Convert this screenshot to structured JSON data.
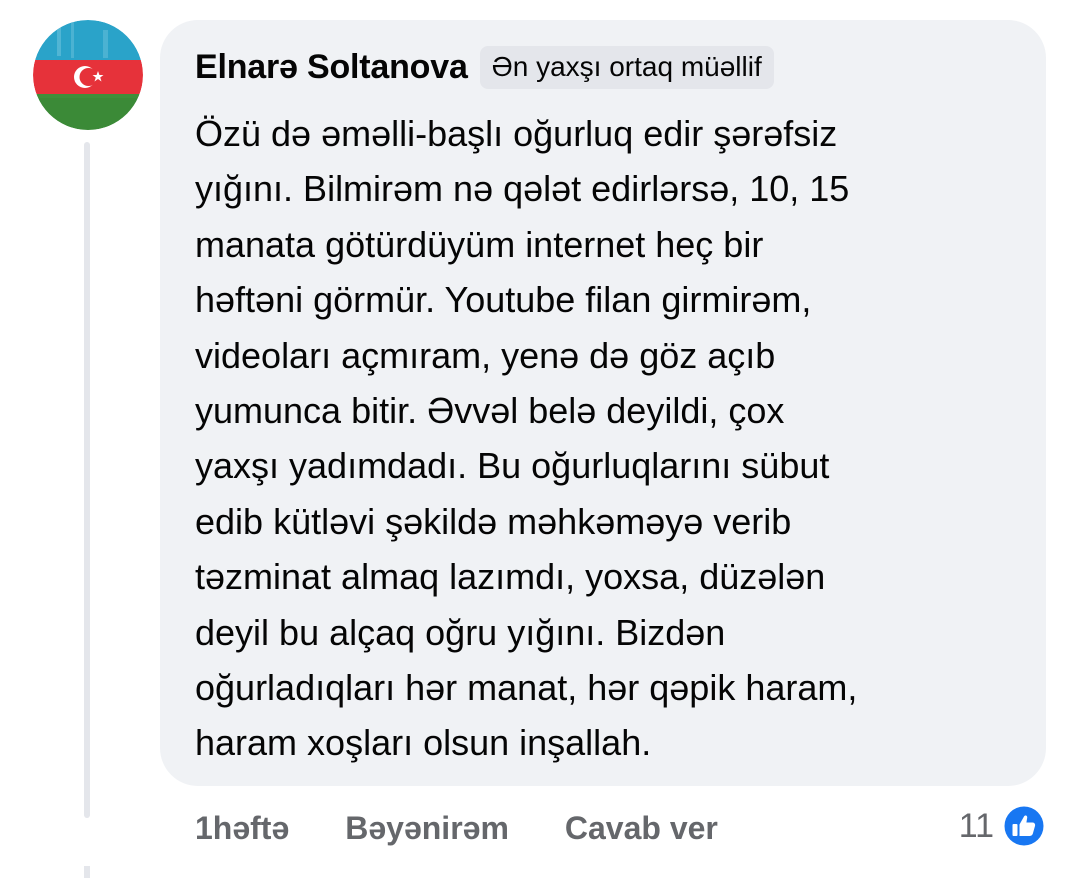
{
  "comment": {
    "author": "Elnarə Soltanova",
    "badge": "Ən yaxşı ortaq müəllif",
    "text": "Özü də əməlli-başlı oğurluq edir şərəfsiz\nyığını. Bilmirəm nə qələt edirlərsə, 10, 15\nmanata götürdüyüm internet heç bir\nhəftəni görmür. Youtube filan girmirəm,\nvideoları açmıram, yenə də göz açıb\nyumunca bitir. Əvvəl belə deyildi, çox\nyaxşı yadımdadı. Bu oğurluqlarını sübut\nedib kütləvi şəkildə məhkəməyə verib\ntəzminat almaq lazımdı, yoxsa, düzələn\ndeyil bu alçaq oğru yığını. Bizdən\noğurladıqları hər manat, hər qəpik haram,\nharam xoşları olsun inşallah."
  },
  "actions": {
    "time": "1həftə",
    "like_label": "Bəyənirəm",
    "reply_label": "Cavab ver"
  },
  "reactions": {
    "count": "11",
    "icon": "like-thumbs-up-icon"
  },
  "avatar": {
    "icon": "azerbaijan-flag-avatar"
  },
  "colors": {
    "bubble": "#f0f2f5",
    "badge": "#e4e6eb",
    "secondary_text": "#65676b",
    "like_blue": "#1877f2",
    "flag_blue": "#00b5e2",
    "flag_red": "#ef3340",
    "flag_green": "#509e2f"
  }
}
